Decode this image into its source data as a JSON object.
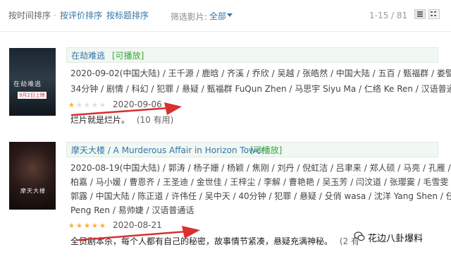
{
  "toolbar": {
    "sort_time": "按时间排序",
    "sort_rating": "按评价排序",
    "sort_title": "按标题排序",
    "separator": "·",
    "filter_label": "筛选影片:",
    "filter_value": "全部",
    "pagination": "1-15 / 81"
  },
  "movies": [
    {
      "title": "在劫难逃",
      "playable": "[可播放]",
      "poster_text": "在劫难逃",
      "poster_date": "9月2日上映",
      "meta": [
        "2020-09-02(中国大陆) / 王千源 / 鹿晗 / 齐溪 / 乔欣 / 吴越 / 张皓然 / 中国大陆 / 五百 / 甄福群 / 娄譬 /",
        "34分钟 / 剧情 / 科幻 / 犯罪 / 悬疑 / 甄福群 FuQun Zhen / 马思宇 Siyu Ma / 仁络 Ke Ren / 汉语普通话"
      ],
      "rating": 1,
      "rating_max": 5,
      "date": "2020-09-06",
      "comment": "烂片就是烂片。",
      "useful": "(10 有用)"
    },
    {
      "title": "摩天大楼 / A Murderous Affair in Horizon Tower",
      "playable": "[可播放]",
      "poster_text": "摩天大楼",
      "meta": [
        "2020-08-19(中国大陆) / 郭涛 / 杨子姗 / 杨颖 / 焦刚 / 刘丹 / 倪虹洁 / 吕聿来 / 郑人硕 / 马亮 / 孔雁 / 张",
        "柏嘉 / 马小媛 / 曹恩齐 / 王圣迪 / 金世佳 / 王梓尘 / 李解 / 曹艳艳 / 吴玉芳 / 闫汶道 / 张璎霙 / 毛雪雯 /",
        "郭露 / 中国大陆 / 陈正道 / 许伟任 / 吴中天 / 40分钟 / 犯罪 / 悬疑 / 殳俏 wasa / 沈洋 Yang Shen / 任鹏",
        "Peng Ren / 易帅婕 / 汉语普通话"
      ],
      "rating": 5,
      "rating_max": 5,
      "date": "2020-08-21",
      "comment": "全员剧本杀，每个人都有自己的秘密，故事情节紧凑，悬疑充满神秘。",
      "useful": "(2 有"
    }
  ],
  "watermark": "花边八卦爆料",
  "colors": {
    "link": "#3377aa",
    "playable": "#33aa33",
    "star": "#ffac2d",
    "arrow": "#d93030",
    "title_bg": "#f1f7f2"
  },
  "icons": [
    "list-view-icon",
    "grid-view-icon",
    "chevron-down-icon",
    "star-icon",
    "arrow-annotation-icon",
    "wechat-icon"
  ]
}
